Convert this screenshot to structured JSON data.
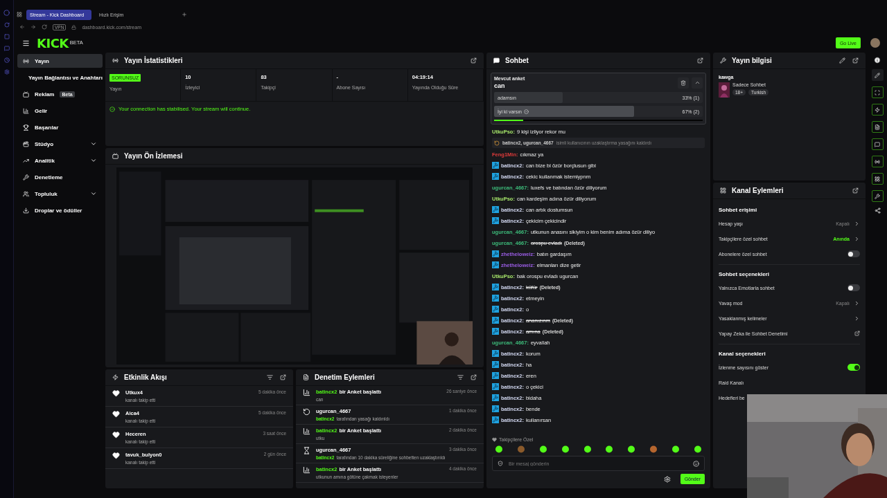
{
  "browser": {
    "tabs": [
      {
        "label": "Stream - Kick Dashboard",
        "selected": true
      },
      {
        "label": "Hızlı Erişim",
        "selected": false
      }
    ],
    "vpn": "VPN",
    "url": "dashboard.kick.com/stream"
  },
  "header": {
    "logo": "KICK",
    "logo_badge": "BETA",
    "go_live": "Go Live"
  },
  "sidebar": {
    "items": [
      {
        "kind": "main",
        "label": "Yayın",
        "selected": true
      },
      {
        "kind": "sub",
        "label": "Yayın Bağlantısı ve Anahtarı",
        "selected": false
      },
      {
        "kind": "main",
        "label": "Reklam",
        "badge": "Beta",
        "selected": false
      },
      {
        "kind": "main",
        "label": "Gelir",
        "selected": false
      },
      {
        "kind": "main",
        "label": "Başarılar",
        "selected": false
      },
      {
        "kind": "main",
        "label": "Stüdyo",
        "selected": false,
        "expanded": false
      },
      {
        "kind": "main",
        "label": "Analitik",
        "selected": false,
        "expanded": false
      },
      {
        "kind": "main",
        "label": "Denetleme",
        "selected": false
      },
      {
        "kind": "main",
        "label": "Topluluk",
        "selected": false,
        "expanded": false
      },
      {
        "kind": "main",
        "label": "Droplar ve ödüller",
        "selected": false
      }
    ]
  },
  "stats_panel": {
    "title": "Yayın İstatistikleri",
    "stats": [
      {
        "kind": "badge",
        "value": "SORUNSUZ",
        "label": "Yayın"
      },
      {
        "kind": "number",
        "value": "10",
        "label": "İzleyici"
      },
      {
        "kind": "number",
        "value": "83",
        "label": "Takipçi"
      },
      {
        "kind": "number",
        "value": "-",
        "label": "Abone Sayısı"
      },
      {
        "kind": "number",
        "value": "04:19:14",
        "label": "Yayında Olduğu Süre"
      }
    ],
    "notice": "Your connection has stabilised. Your stream will continue."
  },
  "preview": {
    "title": "Yayın Ön İzlemesi",
    "kind": "picture"
  },
  "activity": {
    "title": "Etkinlik Akışı",
    "items": [
      {
        "name": "Utkux4",
        "detail": "kanalı takip etti",
        "time": "5 dakika önce"
      },
      {
        "name": "Aica4",
        "detail": "kanalı takip etti",
        "time": "5 dakika önce"
      },
      {
        "name": "Heceren",
        "detail": "kanalı takip etti",
        "time": "3 saat önce"
      },
      {
        "name": "tavuk_bulyon0",
        "detail": "kanalı takip etti",
        "time": "2 gün önce"
      }
    ]
  },
  "moderation": {
    "title": "Denetim Eylemleri",
    "items": [
      {
        "kind": "poll",
        "title_parts": [
          {
            "text": "batincx2",
            "accent": true
          },
          {
            "text": "bir Anket başlattı",
            "accent": false
          }
        ],
        "detail_parts": [
          {
            "text": "can",
            "accent": false
          }
        ],
        "time": "26 saniye önce"
      },
      {
        "kind": "unban",
        "title_parts": [
          {
            "text": "ugurcan_4667",
            "accent": false
          }
        ],
        "detail_parts": [
          {
            "text": "batincx2",
            "accent": true
          },
          {
            "text": "tarafından yasağı kaldırıldı",
            "accent": false
          }
        ],
        "time": "1 dakika önce"
      },
      {
        "kind": "poll",
        "title_parts": [
          {
            "text": "batincx2",
            "accent": true
          },
          {
            "text": "bir Anket başlattı",
            "accent": false
          }
        ],
        "detail_parts": [
          {
            "text": "utku",
            "accent": false
          }
        ],
        "time": "2 dakika önce"
      },
      {
        "kind": "timeout",
        "title_parts": [
          {
            "text": "ugurcan_4667",
            "accent": false
          }
        ],
        "detail_parts": [
          {
            "text": "batincx2",
            "accent": true
          },
          {
            "text": "tarafından 10 dakika süreliğine sohbetten uzaklaştırıldı",
            "accent": false
          }
        ],
        "time": "3 dakika önce"
      },
      {
        "kind": "poll",
        "title_parts": [
          {
            "text": "batincx2",
            "accent": true
          },
          {
            "text": "bir Anket başlattı",
            "accent": false
          }
        ],
        "detail_parts": [
          {
            "text": "utkunun amına götüne çakmak isteyenler",
            "accent": false
          }
        ],
        "time": "4 dakika önce"
      }
    ]
  },
  "chat": {
    "title": "Sohbet",
    "poll": {
      "heading": "Mevcut anket",
      "question": "can",
      "options": [
        {
          "label": "adamsın",
          "result": "33% (1)",
          "level": 0.33,
          "selected": false
        },
        {
          "label": "İyi ki varsın",
          "result": "67% (2)",
          "level": 0.67,
          "selected": true
        }
      ],
      "timer": {
        "level": 0.14
      }
    },
    "messages": [
      {
        "kind": "message",
        "user": "UtkuPso:",
        "color": "#a8e86b",
        "badge": false,
        "text": "9 kişi izliyor rekor mu",
        "deleted": false
      },
      {
        "kind": "system",
        "users": "batincx2, ugurcan_4667",
        "text": "isimli kullanıcının uzaklaştırma yasağını kaldırdı"
      },
      {
        "kind": "message",
        "user": "Feng1Min:",
        "color": "#e03b3b",
        "badge": false,
        "text": "cıkmaz ya",
        "deleted": false
      },
      {
        "kind": "message",
        "user": "batincx2:",
        "color": "#d6dcf5",
        "badge": true,
        "text": "can bize bi özür borçlusun gibi",
        "deleted": false
      },
      {
        "kind": "message",
        "user": "batincx2:",
        "color": "#d6dcf5",
        "badge": true,
        "text": "cekic kullanmak istemiyprım",
        "deleted": false
      },
      {
        "kind": "message",
        "user": "ugurcan_4667:",
        "color": "#3dbb7a",
        "badge": false,
        "text": "luxefs ve batından özür diliyorum",
        "deleted": false
      },
      {
        "kind": "message",
        "user": "UtkuPso:",
        "color": "#a8e86b",
        "badge": false,
        "text": "can kardeşim adına özür diliyorum",
        "deleted": false
      },
      {
        "kind": "message",
        "user": "batincx2:",
        "color": "#d6dcf5",
        "badge": true,
        "text": "can artık dostumsun",
        "deleted": false
      },
      {
        "kind": "message",
        "user": "batincx2:",
        "color": "#d6dcf5",
        "badge": true,
        "text": "çekicim çekicindir",
        "deleted": false
      },
      {
        "kind": "message",
        "user": "ugurcan_4667:",
        "color": "#3dbb7a",
        "badge": false,
        "text": "utkunun anasını sikiyim o kim benim adıma özür diliyo",
        "deleted": false
      },
      {
        "kind": "message",
        "user": "ugurcan_4667:",
        "color": "#3dbb7a",
        "badge": false,
        "text": "orospu evladı",
        "deleted": true,
        "deleted_label": "(Deleted)"
      },
      {
        "kind": "message",
        "user": "zhetheloweiz:",
        "color": "#9b5de5",
        "badge": true,
        "text": "batın gardaşım",
        "deleted": false
      },
      {
        "kind": "message",
        "user": "zhetheloweiz:",
        "color": "#9b5de5",
        "badge": true,
        "text": "elmanları dize getir",
        "deleted": false
      },
      {
        "kind": "message",
        "user": "UtkuPso:",
        "color": "#a8e86b",
        "badge": false,
        "text": "bak orospu evladı ugurcan",
        "deleted": false
      },
      {
        "kind": "message",
        "user": "batincx2:",
        "color": "#d6dcf5",
        "badge": true,
        "text": "küfür",
        "deleted": true,
        "deleted_label": "(Deleted)"
      },
      {
        "kind": "message",
        "user": "batincx2:",
        "color": "#d6dcf5",
        "badge": true,
        "text": "etmeyin",
        "deleted": false
      },
      {
        "kind": "message",
        "user": "batincx2:",
        "color": "#d6dcf5",
        "badge": true,
        "text": "o",
        "deleted": false
      },
      {
        "kind": "message",
        "user": "batincx2:",
        "color": "#d6dcf5",
        "badge": true,
        "text": "ananızınm",
        "deleted": true,
        "deleted_label": "(Deleted)"
      },
      {
        "kind": "message",
        "user": "batincx2:",
        "color": "#d6dcf5",
        "badge": true,
        "text": "amına",
        "deleted": true,
        "deleted_label": "(Deleted)"
      },
      {
        "kind": "message",
        "user": "ugurcan_4667:",
        "color": "#3dbb7a",
        "badge": false,
        "text": "eyvallah",
        "deleted": false
      },
      {
        "kind": "message",
        "user": "batincx2:",
        "color": "#d6dcf5",
        "badge": true,
        "text": "korum",
        "deleted": false
      },
      {
        "kind": "message",
        "user": "batincx2:",
        "color": "#d6dcf5",
        "badge": true,
        "text": "ha",
        "deleted": false
      },
      {
        "kind": "message",
        "user": "batincx2:",
        "color": "#d6dcf5",
        "badge": true,
        "text": "eren",
        "deleted": false
      },
      {
        "kind": "message",
        "user": "batincx2:",
        "color": "#d6dcf5",
        "badge": true,
        "text": "o çekici",
        "deleted": false
      },
      {
        "kind": "message",
        "user": "batincx2:",
        "color": "#d6dcf5",
        "badge": true,
        "text": "bidaha",
        "deleted": false
      },
      {
        "kind": "message",
        "user": "batincx2:",
        "color": "#d6dcf5",
        "badge": true,
        "text": "bende",
        "deleted": false
      },
      {
        "kind": "message",
        "user": "batincx2:",
        "color": "#d6dcf5",
        "badge": true,
        "text": "kullanırsan",
        "deleted": false
      }
    ],
    "followers_label": "Takipçilere Özel",
    "emotes": [
      {
        "color": "#53fc18"
      },
      {
        "color": "#8a5a2b"
      },
      {
        "color": "#53fc18"
      },
      {
        "color": "#53fc18"
      },
      {
        "color": "#53fc18"
      },
      {
        "color": "#53fc18"
      },
      {
        "color": "#53fc18"
      },
      {
        "color": "#b5652e"
      },
      {
        "color": "#53fc18"
      },
      {
        "color": "#53fc18"
      }
    ],
    "placeholder": "Bir mesaj gönderin",
    "send": "Gönder"
  },
  "stream_info": {
    "title": "Yayın bilgisi",
    "stream_title": "kawga",
    "category": "Sadece Sohbet",
    "tags": [
      "18+",
      "Turkish"
    ]
  },
  "channel_actions": {
    "title": "Kanal Eylemleri",
    "sections": [
      {
        "title": "Sohbet erişimi",
        "rows": [
          {
            "kind": "link",
            "label": "Hesap yaşı",
            "value": "Kapalı",
            "accent": false
          },
          {
            "kind": "link",
            "label": "Takipçilere özel sohbet",
            "value": "Anında",
            "accent": true
          },
          {
            "kind": "toggle",
            "label": "Abonelere özel sohbet",
            "on": false
          }
        ]
      },
      {
        "title": "Sohbet seçenekleri",
        "rows": [
          {
            "kind": "toggle",
            "label": "Yalnızca Emotlarla sohbet",
            "on": false
          },
          {
            "kind": "link",
            "label": "Yavaş mod",
            "value": "Kapalı",
            "accent": false
          },
          {
            "kind": "link",
            "label": "Yasaklanmış kelimeler"
          },
          {
            "kind": "external",
            "label": "Yapay Zeka ile Sohbet Denetimi"
          }
        ]
      },
      {
        "title": "Kanal seçenekleri",
        "rows": [
          {
            "kind": "toggle",
            "label": "İzlenme sayısını göster",
            "on": true
          },
          {
            "kind": "plain",
            "label": "Raid Kanalı"
          },
          {
            "kind": "plain",
            "label": "Hedefleri be"
          }
        ]
      }
    ]
  }
}
